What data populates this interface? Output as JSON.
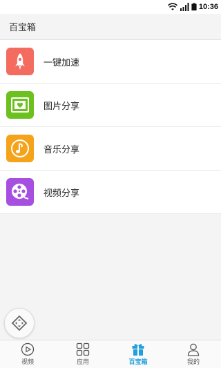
{
  "status_bar": {
    "time": "10:36",
    "icons": [
      "wifi-icon",
      "signal-icon",
      "battery-icon"
    ]
  },
  "header": {
    "title": "百宝箱"
  },
  "list": {
    "items": [
      {
        "label": "一键加速",
        "icon": "rocket-icon",
        "color": "#f36c5f"
      },
      {
        "label": "图片分享",
        "icon": "picture-icon",
        "color": "#6cc11e"
      },
      {
        "label": "音乐分享",
        "icon": "music-note-icon",
        "color": "#f5a31a"
      },
      {
        "label": "视频分享",
        "icon": "film-reel-icon",
        "color": "#a64fe0"
      }
    ]
  },
  "floating_button": {
    "icon": "direction-pad-icon"
  },
  "tabbar": {
    "tabs": [
      {
        "label": "视频",
        "icon": "play-circle-icon",
        "active": false
      },
      {
        "label": "应用",
        "icon": "app-grid-icon",
        "active": false
      },
      {
        "label": "百宝箱",
        "icon": "gift-icon",
        "active": true
      },
      {
        "label": "我的",
        "icon": "person-icon",
        "active": false
      }
    ],
    "active_color": "#22a0dc"
  }
}
